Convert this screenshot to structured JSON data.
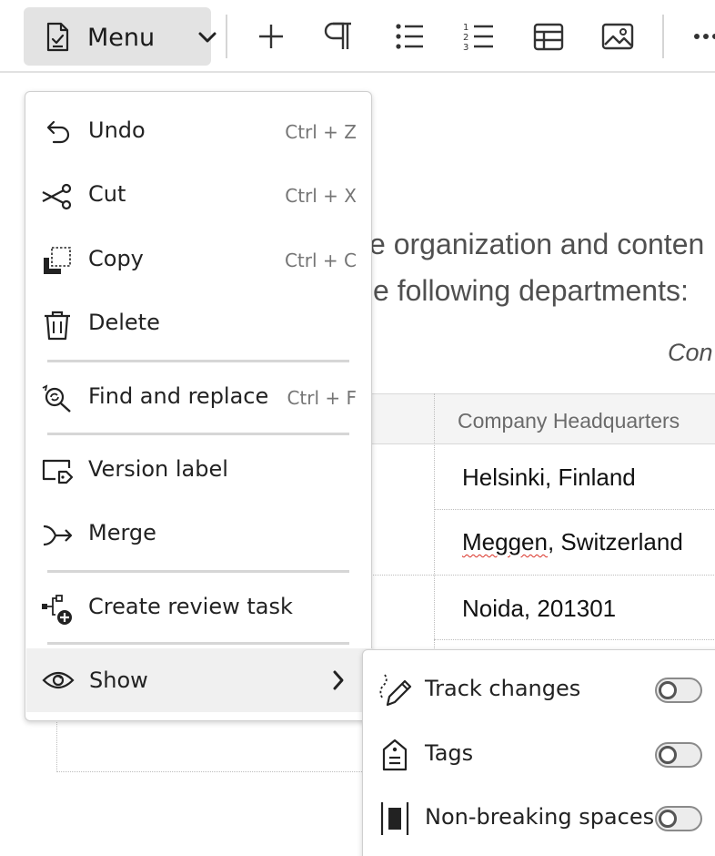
{
  "toolbar": {
    "menu_label": "Menu",
    "icons": [
      "plus-icon",
      "paragraph-icon",
      "bulleted-list-icon",
      "numbered-list-icon",
      "table-icon",
      "image-icon",
      "more-icon"
    ]
  },
  "document": {
    "line1": "e organization and conten",
    "line2": "e following departments:",
    "caption": "Con",
    "table": {
      "header": "Company Headquarters",
      "rows": [
        "Helsinki, Finland",
        "Meggen, Switzerland",
        "Noida, 201301"
      ]
    }
  },
  "menu": {
    "items": [
      {
        "label": "Undo",
        "shortcut": "Ctrl + Z",
        "icon": "undo-icon"
      },
      {
        "label": "Cut",
        "shortcut": "Ctrl + X",
        "icon": "scissors-icon"
      },
      {
        "label": "Copy",
        "shortcut": "Ctrl + C",
        "icon": "copy-icon"
      },
      {
        "label": "Delete",
        "shortcut": "",
        "icon": "trash-icon"
      },
      {
        "label": "Find and replace",
        "shortcut": "Ctrl + F",
        "icon": "find-replace-icon"
      },
      {
        "label": "Version label",
        "shortcut": "",
        "icon": "version-label-icon"
      },
      {
        "label": "Merge",
        "shortcut": "",
        "icon": "merge-icon"
      },
      {
        "label": "Create review task",
        "shortcut": "",
        "icon": "review-task-icon"
      },
      {
        "label": "Show",
        "shortcut": "",
        "icon": "eye-icon"
      }
    ]
  },
  "submenu": {
    "items": [
      {
        "label": "Track changes",
        "on": false,
        "icon": "track-changes-icon"
      },
      {
        "label": "Tags",
        "on": false,
        "icon": "tag-icon"
      },
      {
        "label": "Non-breaking spaces",
        "on": false,
        "icon": "non-breaking-space-icon"
      }
    ]
  }
}
